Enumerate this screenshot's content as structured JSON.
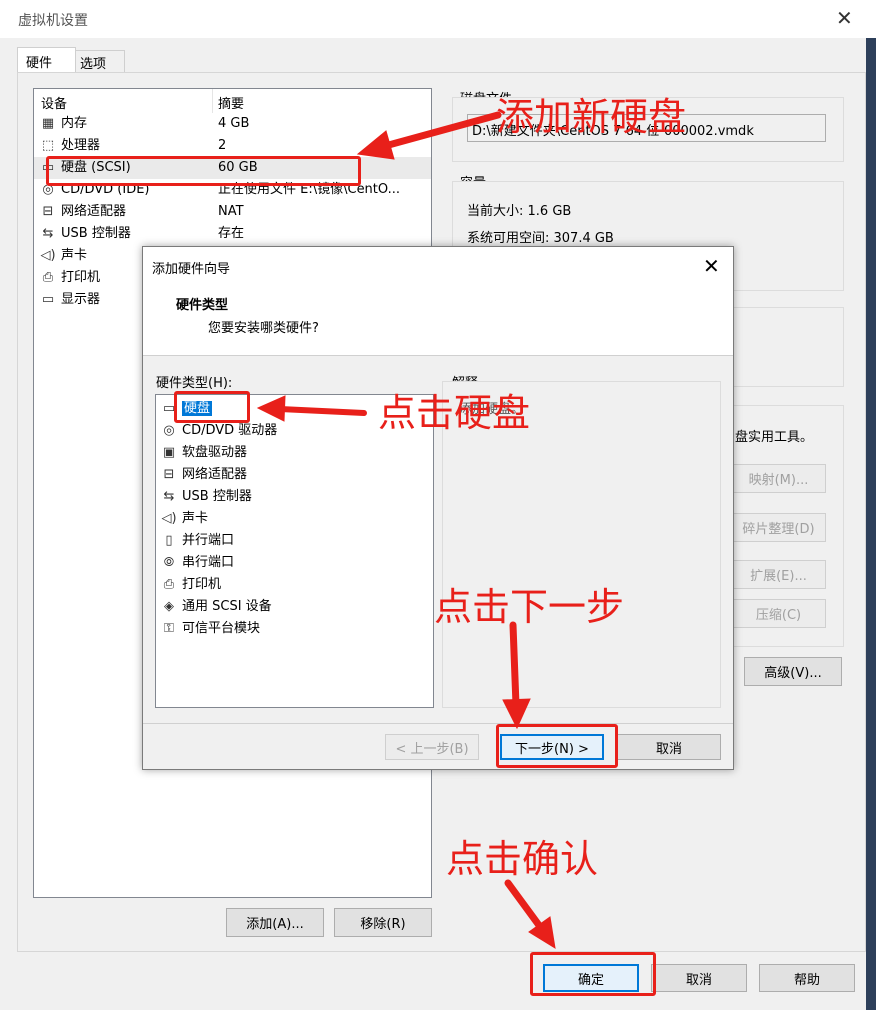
{
  "window": {
    "title": "虚拟机设置",
    "tabs": [
      "硬件",
      "选项"
    ]
  },
  "device_list": {
    "headers": [
      "设备",
      "摘要"
    ],
    "rows": [
      {
        "icon": "memory-icon",
        "name": "内存",
        "summary": "4 GB"
      },
      {
        "icon": "cpu-icon",
        "name": "处理器",
        "summary": "2"
      },
      {
        "icon": "disk-icon",
        "name": "硬盘 (SCSI)",
        "summary": "60 GB"
      },
      {
        "icon": "cd-icon",
        "name": "CD/DVD (IDE)",
        "summary": "正在使用文件 E:\\镜像\\CentO..."
      },
      {
        "icon": "network-icon",
        "name": "网络适配器",
        "summary": "NAT"
      },
      {
        "icon": "usb-icon",
        "name": "USB 控制器",
        "summary": "存在"
      },
      {
        "icon": "sound-icon",
        "name": "声卡",
        "summary": ""
      },
      {
        "icon": "printer-icon",
        "name": "打印机",
        "summary": ""
      },
      {
        "icon": "display-icon",
        "name": "显示器",
        "summary": ""
      }
    ],
    "add_button": "添加(A)...",
    "remove_button": "移除(R)"
  },
  "right_panel": {
    "disk_file_label": "磁盘文件",
    "disk_file_value": "D:\\新建文件夹\\CentOS 7 64 位-000002.vmdk",
    "capacity_label": "容量",
    "current_size": "当前大小: 1.6 GB",
    "system_free": "系统可用空间: 307.4 GB",
    "utility_text": "盘实用工具。",
    "map_button": "映射(M)...",
    "defrag_button": "碎片整理(D)",
    "expand_button": "扩展(E)...",
    "compact_button": "压缩(C)",
    "advanced_button": "高级(V)..."
  },
  "wizard": {
    "title": "添加硬件向导",
    "heading": "硬件类型",
    "subheading": "您要安装哪类硬件?",
    "list_label": "硬件类型(H):",
    "explain_label": "解释",
    "explain_text": "添加硬盘。",
    "items": [
      {
        "icon": "disk-icon",
        "label": "硬盘"
      },
      {
        "icon": "cd-icon",
        "label": "CD/DVD 驱动器"
      },
      {
        "icon": "floppy-icon",
        "label": "软盘驱动器"
      },
      {
        "icon": "network-icon",
        "label": "网络适配器"
      },
      {
        "icon": "usb-icon",
        "label": "USB 控制器"
      },
      {
        "icon": "sound-icon",
        "label": "声卡"
      },
      {
        "icon": "parallel-port-icon",
        "label": "并行端口"
      },
      {
        "icon": "serial-port-icon",
        "label": "串行端口"
      },
      {
        "icon": "printer-icon",
        "label": "打印机"
      },
      {
        "icon": "scsi-icon",
        "label": "通用 SCSI 设备"
      },
      {
        "icon": "tpm-icon",
        "label": "可信平台模块"
      }
    ],
    "back_button": "< 上一步(B)",
    "next_button": "下一步(N) >",
    "cancel_button": "取消"
  },
  "footer": {
    "ok_button": "确定",
    "cancel_button": "取消",
    "help_button": "帮助"
  },
  "annotations": {
    "add_disk": "添加新硬盘",
    "click_disk": "点击硬盘",
    "click_next": "点击下一步",
    "click_ok": "点击确认"
  },
  "colors": {
    "annotation_red": "#e8201a",
    "selection_blue": "#0078d7"
  }
}
